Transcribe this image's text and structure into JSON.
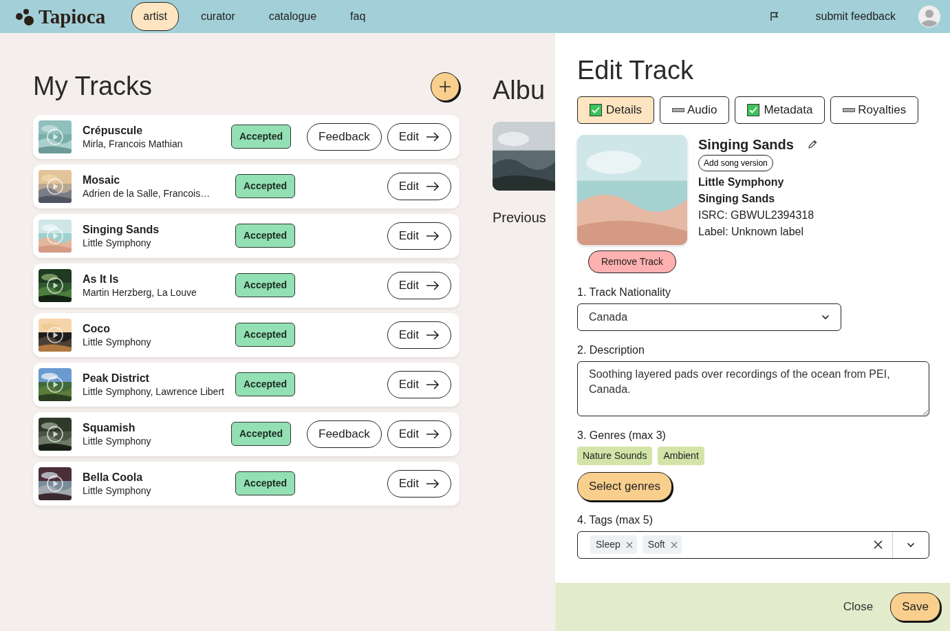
{
  "nav": {
    "logo": "Tapioca",
    "links": [
      {
        "label": "artist",
        "selected": true
      },
      {
        "label": "curator",
        "selected": false
      },
      {
        "label": "catalogue",
        "selected": false
      },
      {
        "label": "faq",
        "selected": false
      }
    ],
    "feedback": "submit feedback"
  },
  "tracks_panel": {
    "title": "My Tracks",
    "tracks": [
      {
        "title": "Crépuscule",
        "artists": "Mirla, Francois Mathian",
        "status": "Accepted",
        "feedback_button": "Feedback",
        "edit_button": "Edit"
      },
      {
        "title": "Mosaic",
        "artists": "Adrien de la Salle, Francois…",
        "status": "Accepted",
        "edit_button": "Edit"
      },
      {
        "title": "Singing Sands",
        "artists": "Little Symphony",
        "status": "Accepted",
        "edit_button": "Edit"
      },
      {
        "title": "As It Is",
        "artists": "Martin Herzberg, La Louve",
        "status": "Accepted",
        "edit_button": "Edit"
      },
      {
        "title": "Coco",
        "artists": "Little Symphony",
        "status": "Accepted",
        "edit_button": "Edit"
      },
      {
        "title": "Peak District",
        "artists": "Little Symphony, Lawrence Libert",
        "status": "Accepted",
        "edit_button": "Edit"
      },
      {
        "title": "Squamish",
        "artists": "Little Symphony",
        "status": "Accepted",
        "feedback_button": "Feedback",
        "edit_button": "Edit"
      },
      {
        "title": "Bella Coola",
        "artists": "Little Symphony",
        "status": "Accepted",
        "edit_button": "Edit"
      }
    ]
  },
  "album_panel": {
    "title": "Albu",
    "subtitle": "Previous"
  },
  "drawer": {
    "title": "Edit Track",
    "tabs": [
      {
        "label": "Details",
        "selected": true,
        "complete": true
      },
      {
        "label": "Audio",
        "selected": false,
        "complete": false
      },
      {
        "label": "Metadata",
        "selected": false,
        "complete": true
      },
      {
        "label": "Royalties",
        "selected": false,
        "complete": false
      }
    ],
    "track": {
      "name": "Singing Sands",
      "version_button": "Add song version",
      "artist": "Little Symphony",
      "album": "Singing Sands",
      "isrc": "ISRC: GBWUL2394318",
      "label": "Label: Unknown label"
    },
    "remove_button": "Remove Track",
    "fields": [
      {
        "kind": "select",
        "label": "1. Track Nationality",
        "value": "Canada"
      },
      {
        "kind": "textarea",
        "label": "2. Description",
        "value": "Soothing layered pads over recordings of the ocean from PEI, Canada."
      },
      {
        "kind": "chips",
        "label": "3. Genres (max 3)",
        "chips": [
          "Nature Sounds",
          "Ambient"
        ],
        "button": "Select genres"
      },
      {
        "kind": "tags",
        "label": "4. Tags (max 5)",
        "tags": [
          "Sleep",
          "Soft"
        ]
      }
    ],
    "footer": {
      "close": "Close",
      "save": "Save"
    }
  }
}
